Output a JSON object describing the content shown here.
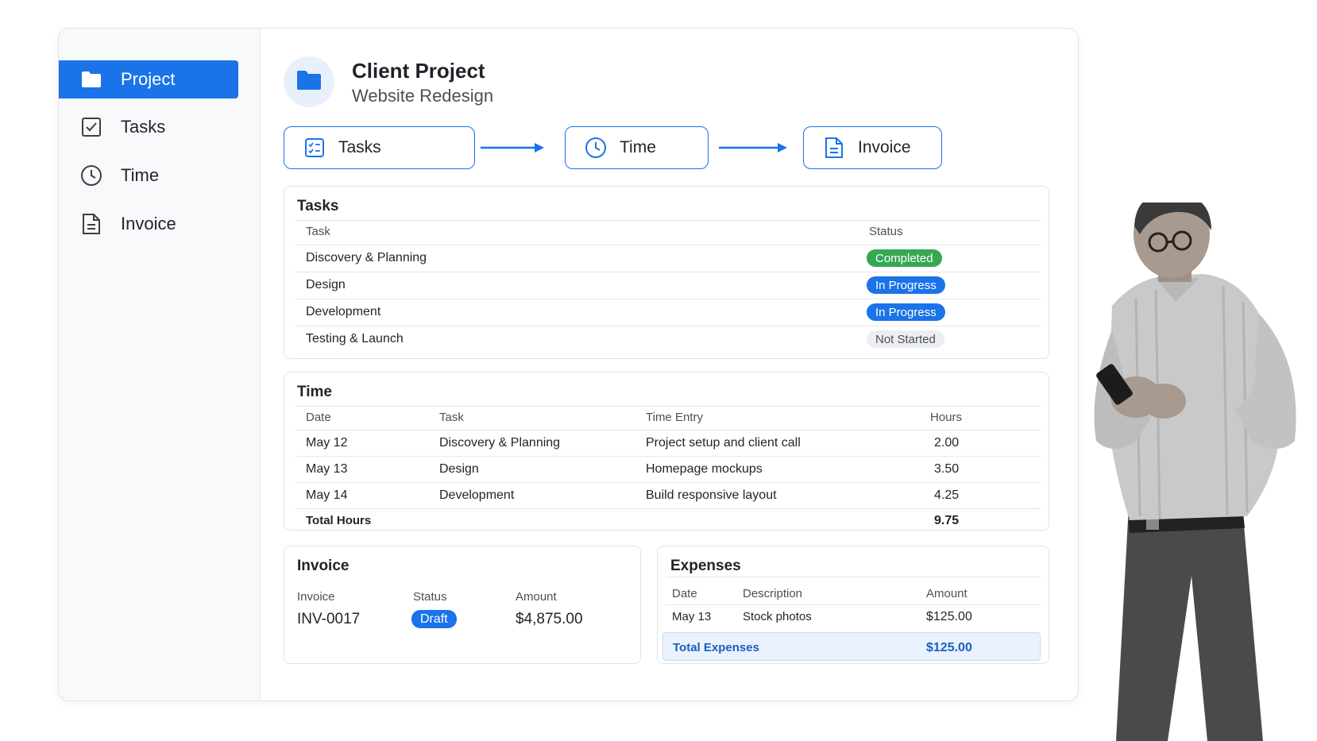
{
  "sidebar": {
    "items": [
      {
        "label": "Project",
        "icon": "folder-icon",
        "active": true
      },
      {
        "label": "Tasks",
        "icon": "checkbox-icon",
        "active": false
      },
      {
        "label": "Time",
        "icon": "clock-icon",
        "active": false
      },
      {
        "label": "Invoice",
        "icon": "document-icon",
        "active": false
      }
    ]
  },
  "header": {
    "title": "Client Project",
    "subtitle": "Website Redesign",
    "icon": "folder-icon"
  },
  "workflow": {
    "steps": [
      {
        "label": "Tasks",
        "icon": "checklist-icon"
      },
      {
        "label": "Time",
        "icon": "clock-icon"
      },
      {
        "label": "Invoice",
        "icon": "document-icon"
      }
    ]
  },
  "tasks": {
    "title": "Tasks",
    "columns": [
      "Task",
      "Status"
    ],
    "rows": [
      {
        "task": "Discovery & Planning",
        "status": "Completed",
        "status_color": "#34a853"
      },
      {
        "task": "Design",
        "status": "In Progress",
        "status_color": "#1a73e8"
      },
      {
        "task": "Development",
        "status": "In Progress",
        "status_color": "#1a73e8"
      },
      {
        "task": "Testing & Launch",
        "status": "Not Started",
        "status_color": "#eceef1"
      }
    ]
  },
  "time": {
    "title": "Time",
    "columns": [
      "Date",
      "Task",
      "Time Entry",
      "Hours"
    ],
    "rows": [
      {
        "date": "May 12",
        "task": "Discovery & Planning",
        "entry": "Project setup and client call",
        "hours": "2.00"
      },
      {
        "date": "May 13",
        "task": "Design",
        "entry": "Homepage mockups",
        "hours": "3.50"
      },
      {
        "date": "May 14",
        "task": "Development",
        "entry": "Build responsive layout",
        "hours": "4.25"
      }
    ],
    "total_label": "Total Hours",
    "total_value": "9.75"
  },
  "invoice": {
    "title": "Invoice",
    "columns": [
      "Invoice",
      "Status",
      "Amount"
    ],
    "number": "INV-0017",
    "status": "Draft",
    "amount": "$4,875.00"
  },
  "expenses": {
    "title": "Expenses",
    "columns": [
      "Date",
      "Description",
      "Amount"
    ],
    "rows": [
      {
        "date": "May 13",
        "description": "Stock photos",
        "amount": "$125.00"
      }
    ],
    "total_label": "Total Expenses",
    "total_value": "$125.00"
  },
  "colors": {
    "accent": "#1a73e8",
    "success": "#34a853",
    "neutral": "#eceef1"
  }
}
